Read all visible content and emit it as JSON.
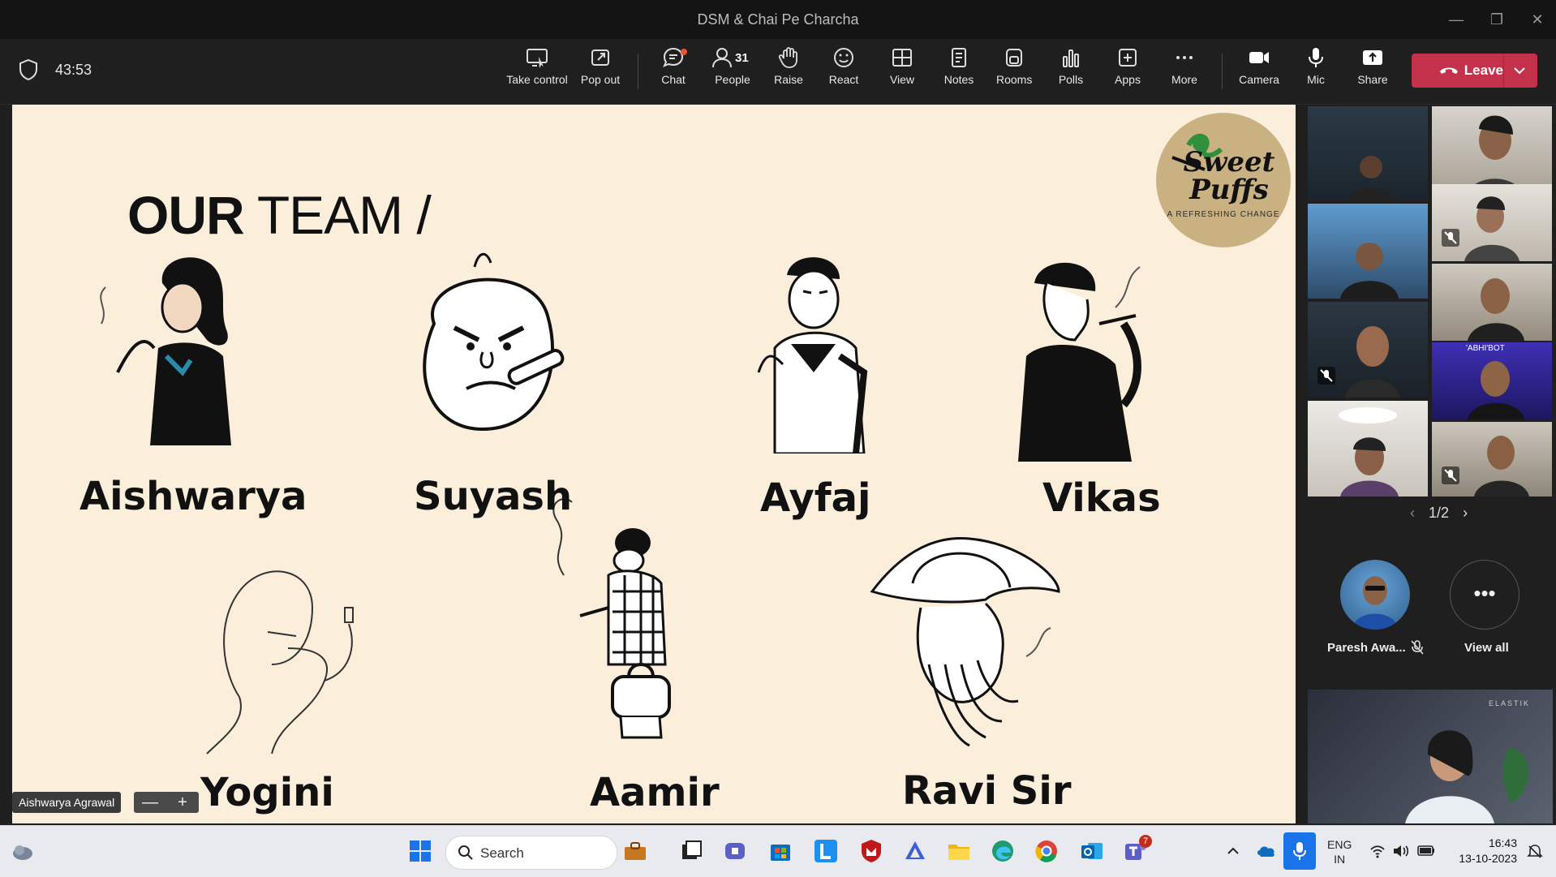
{
  "window": {
    "title": "DSM & Chai Pe Charcha"
  },
  "meeting": {
    "timer": "43:53"
  },
  "toolbar": {
    "take_control": "Take control",
    "pop_out": "Pop out",
    "chat": "Chat",
    "people": "People",
    "people_count": "31",
    "raise": "Raise",
    "react": "React",
    "view": "View",
    "notes": "Notes",
    "rooms": "Rooms",
    "polls": "Polls",
    "apps": "Apps",
    "more": "More",
    "camera": "Camera",
    "mic": "Mic",
    "share": "Share",
    "leave": "Leave"
  },
  "slide": {
    "title_bold": "OUR",
    "title_rest": "TEAM /",
    "logo_text": "Sweet Puffs",
    "logo_tagline": "A REFRESHING CHANGE",
    "team": [
      "Aishwarya",
      "Suyash",
      "Ayfaj",
      "Vikas",
      "Yogini",
      "Aamir",
      "Ravi Sir"
    ]
  },
  "presenter": {
    "name": "Aishwarya Agrawal"
  },
  "zoom": {
    "minus": "—",
    "plus": "+"
  },
  "gallery": {
    "page": "1/2",
    "tile_overlay_text": "'ABHI'BOT",
    "featured_name": "Paresh Awa...",
    "view_all": "View all",
    "selfview_brand": "ELASTIK"
  },
  "taskbar": {
    "search_placeholder": "Search",
    "lang_top": "ENG",
    "lang_bottom": "IN",
    "time": "16:43",
    "date": "13-10-2023",
    "teams_badge": "7"
  }
}
